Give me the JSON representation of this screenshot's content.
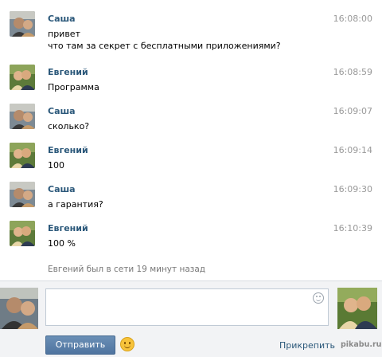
{
  "messages": [
    {
      "author": "Саша",
      "time": "16:08:00",
      "text": "привет\nчто там за секрет с бесплатными приложениями?"
    },
    {
      "author": "Евгений",
      "time": "16:08:59",
      "text": "Программа"
    },
    {
      "author": "Саша",
      "time": "16:09:07",
      "text": "сколько?"
    },
    {
      "author": "Евгений",
      "time": "16:09:14",
      "text": "100"
    },
    {
      "author": "Саша",
      "time": "16:09:30",
      "text": "а гарантия?"
    },
    {
      "author": "Евгений",
      "time": "16:10:39",
      "text": "100 %"
    }
  ],
  "status": {
    "last_seen": "Евгений был в сети 19 минут назад"
  },
  "composer": {
    "input_value": "",
    "send_label": "Отправить",
    "attach_label": "Прикрепить",
    "emoji_icon": "smiley-icon"
  },
  "watermark": "pikabu.ru",
  "colors": {
    "author_name": "#2b587a",
    "time": "#999999",
    "send_button": "#5b7fa8",
    "composer_bg": "#f2f3f5"
  }
}
